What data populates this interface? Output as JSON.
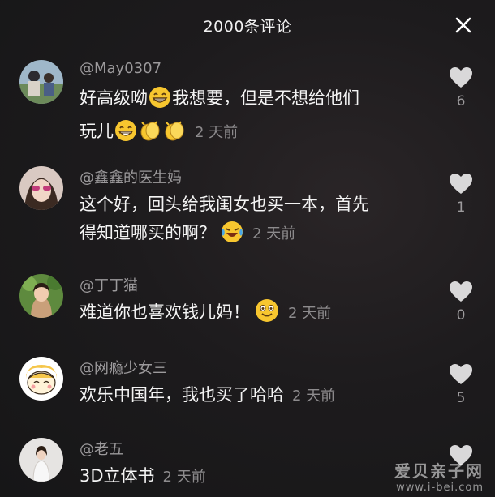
{
  "header": {
    "title": "2000条评论"
  },
  "comments": [
    {
      "user": "@May0307",
      "text_a": "好高级呦",
      "text_b": "我想要，但是不想给他们",
      "text_c": "玩儿",
      "time": "2 天前",
      "likes": "6"
    },
    {
      "user": "@鑫鑫的医生妈",
      "text_a": "这个好，回头给我闺女也买一本，首先",
      "text_b": "得知道哪买的啊？",
      "time": "2 天前",
      "likes": "1"
    },
    {
      "user": "@丁丁猫",
      "text_a": "难道你也喜欢钱儿妈！",
      "time": "2 天前",
      "likes": "0"
    },
    {
      "user": "@网瘾少女三",
      "text_a": "欢乐中国年，我也买了哈哈",
      "time": "2 天前",
      "likes": "5"
    },
    {
      "user": "@老五",
      "text_a": "3D立体书",
      "time": "2 天前",
      "likes": ""
    }
  ],
  "watermark": {
    "line1": "爱贝亲子网",
    "line2": "www.i-bei.com"
  },
  "icons": {
    "close": "close-icon",
    "heart": "heart-icon",
    "emoji_grin": "grin-emoji-icon",
    "emoji_clap": "clap-emoji-icon",
    "emoji_laugh_cry": "laugh-cry-emoji-icon",
    "emoji_smile": "smile-emoji-icon"
  },
  "colors": {
    "background": "#1b1b1d",
    "text": "#f4f4f4",
    "muted": "#9c9a9c",
    "heart": "#d9d8d9",
    "emoji": "#f7c62f"
  }
}
